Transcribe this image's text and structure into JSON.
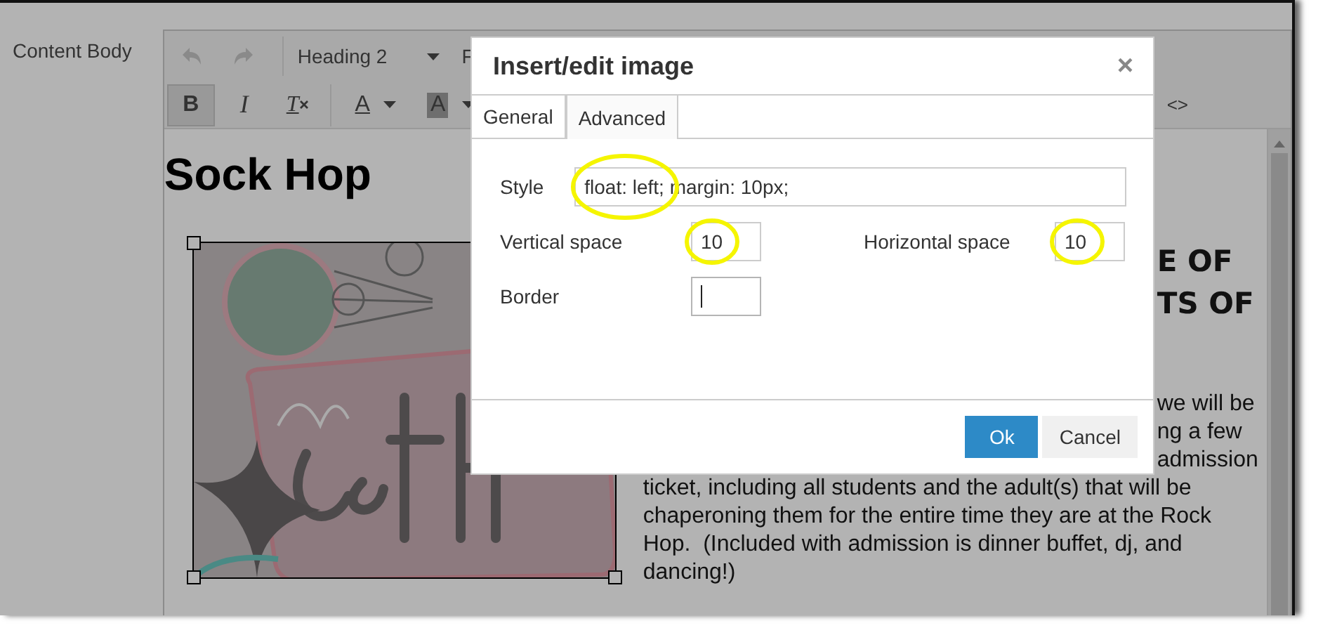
{
  "form_label": "Content Body",
  "toolbar": {
    "row_1": [
      {
        "kind": "undo"
      },
      {
        "kind": "redo"
      },
      {
        "kind": "dropdown",
        "label": "Heading 2"
      },
      {
        "kind": "text",
        "label": "F"
      }
    ],
    "row_2": [
      {
        "kind": "bold",
        "label": "B",
        "selected": true
      },
      {
        "kind": "italic",
        "label": "I",
        "selected": false
      },
      {
        "kind": "clear",
        "label": "T",
        "selected": false
      },
      {
        "kind": "color",
        "label": "A",
        "selected": false
      },
      {
        "kind": "highlight",
        "label": "A",
        "selected": false
      }
    ],
    "code_button": "<>"
  },
  "content": {
    "heading": "Sock Hop",
    "image": {
      "kind": "picture",
      "selected": true
    },
    "heading_fragments": [
      "E OF",
      "TS OF"
    ],
    "paragraph_fragments": [
      "we will be",
      "ng a few",
      "admission"
    ],
    "paragraph_lines": [
      "ticket, including all students and the adult(s) that will be",
      "chaperoning them for the entire time they are at the Rock",
      "Hop.  (Included with admission is dinner buffet, dj, and",
      "dancing!)"
    ]
  },
  "dialog": {
    "title": "Insert/edit image",
    "close": "×",
    "tabs": [
      {
        "label": "General",
        "selected": false
      },
      {
        "label": "Advanced",
        "selected": true
      }
    ],
    "fields": [
      {
        "label": "Style",
        "value": "float: left; margin: 10px;",
        "highlighted": true,
        "focused": false
      },
      {
        "label": "Vertical space",
        "value": "10",
        "highlighted": true,
        "focused": false
      },
      {
        "label": "Horizontal space",
        "value": "10",
        "highlighted": true,
        "focused": false
      },
      {
        "label": "Border",
        "highlighted": false,
        "focused": true
      }
    ],
    "buttons": [
      {
        "label": "Ok",
        "kind": "primary"
      },
      {
        "label": "Cancel",
        "kind": "secondary"
      }
    ]
  }
}
